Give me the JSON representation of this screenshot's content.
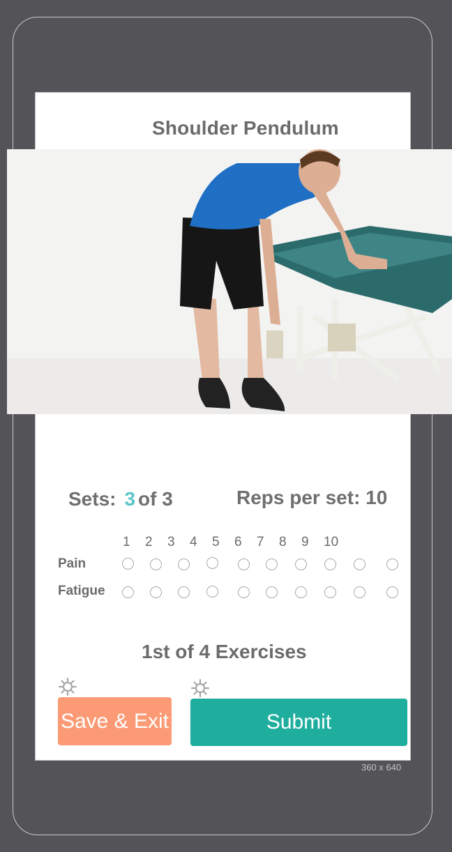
{
  "device": {
    "size_label": "360 x 640"
  },
  "exercise": {
    "title": "Shoulder Pendulum"
  },
  "sets": {
    "label": "Sets:",
    "current": "3",
    "total_text": "of 3"
  },
  "reps": {
    "label_text": "Reps per set: 10"
  },
  "scale": [
    "1",
    "2",
    "3",
    "4",
    "5",
    "6",
    "7",
    "8",
    "9",
    "10"
  ],
  "ratings": {
    "pain_label": "Pain",
    "fatigue_label": "Fatigue",
    "pain_selected": null,
    "fatigue_selected": null
  },
  "progress": {
    "text": "1st of 4 Exercises"
  },
  "buttons": {
    "save_exit": "Save & Exit",
    "submit": "Submit"
  },
  "icons": {
    "save_settings": "gear-icon",
    "submit_settings": "gear-icon"
  },
  "colors": {
    "accent": "#5ec4c8",
    "save_button": "#fb9a74",
    "submit_button": "#1fae9e",
    "device_bg": "#545358"
  }
}
